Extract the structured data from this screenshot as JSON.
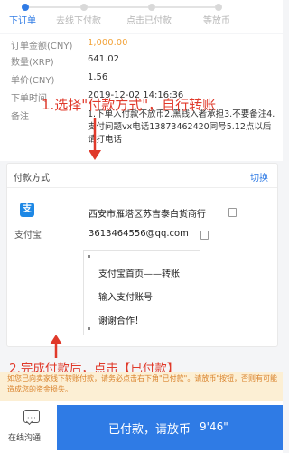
{
  "steps": [
    {
      "label": "下订单"
    },
    {
      "label": "去线下付款"
    },
    {
      "label": "点击已付款"
    },
    {
      "label": "等放币"
    }
  ],
  "order": {
    "rows": [
      {
        "label": "订单金额(CNY)",
        "value": "1,000.00"
      },
      {
        "label": "数量(XRP)",
        "value": "641.02"
      },
      {
        "label": "单价(CNY)",
        "value": "1.56"
      },
      {
        "label": "下单时间",
        "value": "2019-12-02 14:16:36"
      }
    ],
    "note_label": "备注",
    "note_text": "1.下单入付款不放币2.黑钱入者承担3.不要备注4.支付问题vx电话13873462420同号5.12点以后请打电话"
  },
  "payment": {
    "title": "付款方式",
    "switch_label": "切换",
    "method_label": "支付宝",
    "logo_text": "支",
    "payee": "西安市雁塔区苏吉泰白货商行",
    "account": "3613464556@qq.com",
    "instructions": [
      "支付宝首页——转账",
      "输入支付账号",
      "谢谢合作！"
    ]
  },
  "annotations": {
    "step1": "1.选择\"付款方式\"，自行转账",
    "step2": "2.完成付款后，点击【已付款】"
  },
  "warning": "如您已向卖家线下转账付款，请务必点击右下角\"已付款\"。请放币\"按钮，否则有可能造成您的资金损失。",
  "bottom": {
    "chat_label": "在线沟通",
    "paid_label": "已付款，请放币",
    "timer": "9'46\""
  },
  "colors": {
    "accent": "#2f7be5",
    "annotation": "#e0392a",
    "warning_bg": "#fcefd4",
    "warning_text": "#d9822b"
  }
}
